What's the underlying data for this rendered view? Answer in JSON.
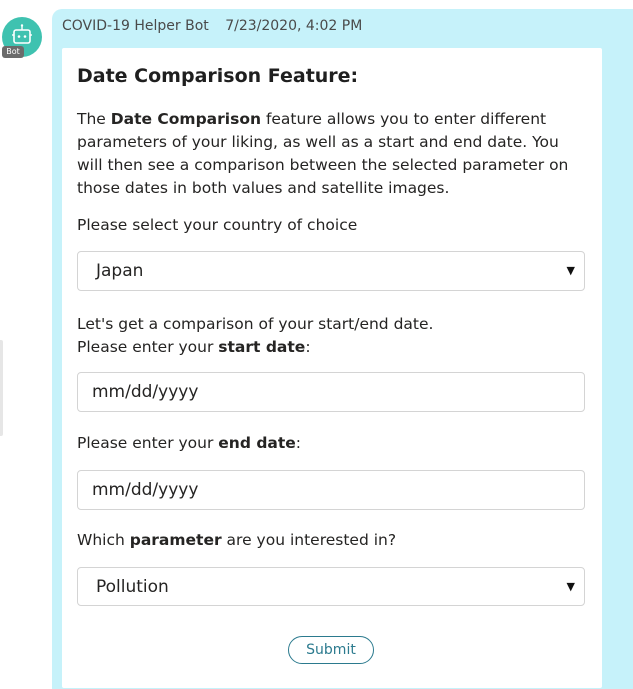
{
  "message": {
    "sender": "COVID-19 Helper Bot",
    "timestamp": "7/23/2020, 4:02 PM",
    "avatar_badge": "Bot",
    "avatar_icon": "bot-icon"
  },
  "card": {
    "title": "Date Comparison Feature:",
    "intro_pre": "The ",
    "intro_bold": "Date Comparison",
    "intro_post": " feature allows you to enter different parameters of your liking, as well as a start and end date. You will then see a comparison between the selected parameter on those dates in both values and satellite images.",
    "country_label": "Please select your country of choice",
    "country_value": "Japan",
    "compare_line": "Let's get a comparison of your start/end date.",
    "start_pre": "Please enter your ",
    "start_bold": "start date",
    "start_post": ":",
    "start_placeholder": "mm/dd/yyyy",
    "end_pre": "Please enter your ",
    "end_bold": "end date",
    "end_post": ":",
    "end_placeholder": "mm/dd/yyyy",
    "param_pre": "Which ",
    "param_bold": "parameter",
    "param_post": " are you interested in?",
    "param_value": "Pollution",
    "submit_label": "Submit"
  },
  "colors": {
    "bubble": "#c6f2fa",
    "avatar": "#3fc2b0",
    "submit_accent": "#2b7a8e"
  }
}
